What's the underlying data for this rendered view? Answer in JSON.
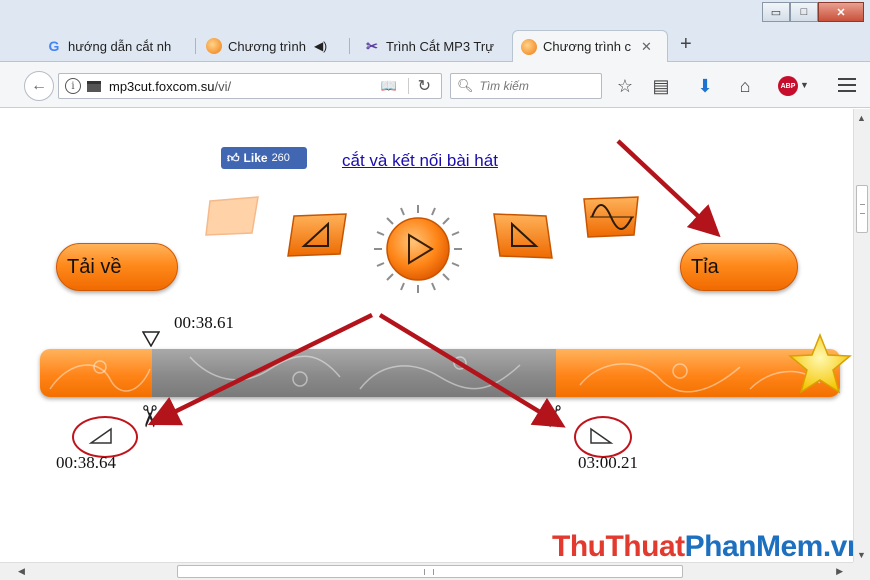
{
  "window": {
    "controls": {
      "minimize": "▭",
      "maximize": "□",
      "close": "✕"
    }
  },
  "tabs": [
    {
      "label": "hướng dẫn cắt nh",
      "icon": "google-icon",
      "active": false
    },
    {
      "label": "Chương trình",
      "icon": "orange-circle-icon",
      "active": false,
      "audio": true
    },
    {
      "label": "Trình Cắt MP3 Trự",
      "icon": "scissors-icon",
      "active": false
    },
    {
      "label": "Chương trình c",
      "icon": "orange-circle-icon",
      "active": true
    }
  ],
  "toolbar": {
    "url_domain": "mp3cut.foxcom.su",
    "url_path": "/vi/",
    "search_placeholder": "Tìm kiếm"
  },
  "page": {
    "like_label": "Like",
    "like_count": "260",
    "link_text": "cắt và kết nối bài hát",
    "download_label": "Tải về",
    "trim_label": "Tỉa",
    "start_marker_time": "00:38.61",
    "start_handle_time": "00:38.64",
    "end_handle_time": "03:00.21",
    "selection_start_fraction": 0.14,
    "selection_end_fraction": 0.645
  },
  "watermark": {
    "part1": "ThuThuat",
    "part2": "PhanMem",
    "part3": ".vn"
  },
  "colors": {
    "orange": "#ff8a1c",
    "arrow_red": "#b3141c",
    "track_gray": "#8f8f8f",
    "link_blue": "#1a0dab",
    "fb_blue": "#4267b2"
  }
}
